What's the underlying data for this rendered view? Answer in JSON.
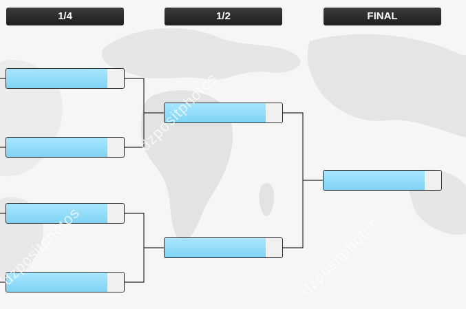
{
  "headers": {
    "quarter": "1/4",
    "semi": "1/2",
    "final": "FINAL"
  },
  "watermarks": [
    "dzpositphotos",
    "dzpositphotos",
    "dzpositphotos"
  ],
  "colors": {
    "header_bg": "#2b2b2b",
    "slot_fill": "#8fdcf8",
    "line": "#2b2b2b"
  }
}
